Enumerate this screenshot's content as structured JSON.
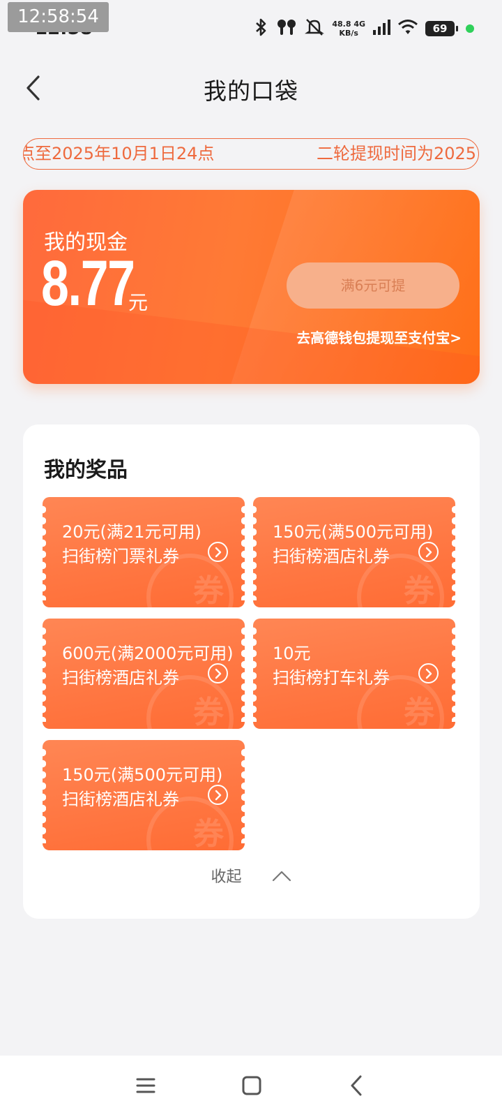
{
  "status_bar": {
    "clock_overlay": "12:58:54",
    "clock": "12:58",
    "net_speed": "48.8",
    "net_unit": "KB/s",
    "net_type": "4G",
    "battery": "69",
    "icons": [
      "bluetooth-icon",
      "earbuds-icon",
      "mute-icon",
      "signal-icon",
      "wifi-icon",
      "battery-icon"
    ]
  },
  "header": {
    "title": "我的口袋",
    "back_icon": "chevron-left-icon"
  },
  "notice": {
    "part1": "点至2025年10月1日24点",
    "part2": "二轮提现时间为2025"
  },
  "cash": {
    "label": "我的现金",
    "amount": "8.77",
    "unit": "元",
    "withdraw_button": "满6元可提",
    "wallet_link": "去高德钱包提现至支付宝>"
  },
  "prizes": {
    "title": "我的奖品",
    "coupons": [
      {
        "line1": "20元(满21元可用)",
        "line2": "扫街榜门票礼券"
      },
      {
        "line1": "150元(满500元可用)",
        "line2": "扫街榜酒店礼券"
      },
      {
        "line1": "600元(满2000元可用)",
        "line2": "扫街榜酒店礼券"
      },
      {
        "line1": "10元",
        "line2": "扫街榜打车礼券"
      },
      {
        "line1": "150元(满500元可用)",
        "line2": "扫街榜酒店礼券"
      }
    ],
    "watermark": "券",
    "collapse_label": "收起"
  },
  "colors": {
    "accent": "#ff6c2c",
    "background": "#f3f3f5"
  }
}
